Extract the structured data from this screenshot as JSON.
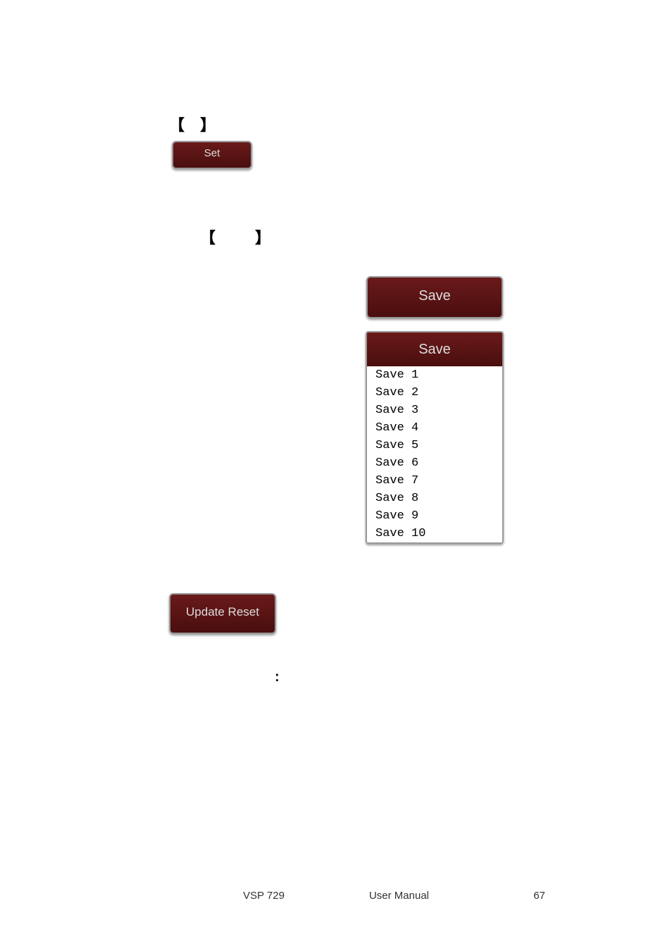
{
  "section_set": {
    "bracket_left": "【",
    "bracket_right": "】",
    "button_label": "Set"
  },
  "section_save": {
    "bracket_left": "【",
    "bracket_right": "】"
  },
  "save_button_label": "Save",
  "save_dropdown": {
    "header": "Save",
    "items": [
      "Save 1",
      "Save 2",
      "Save 3",
      "Save 4",
      "Save 5",
      "Save 6",
      "Save 7",
      "Save 8",
      "Save 9",
      "Save 10"
    ]
  },
  "update_reset_label": "Update Reset",
  "colon": ":",
  "footer": {
    "left": "VSP 729",
    "center": "User Manual",
    "page": "67"
  }
}
